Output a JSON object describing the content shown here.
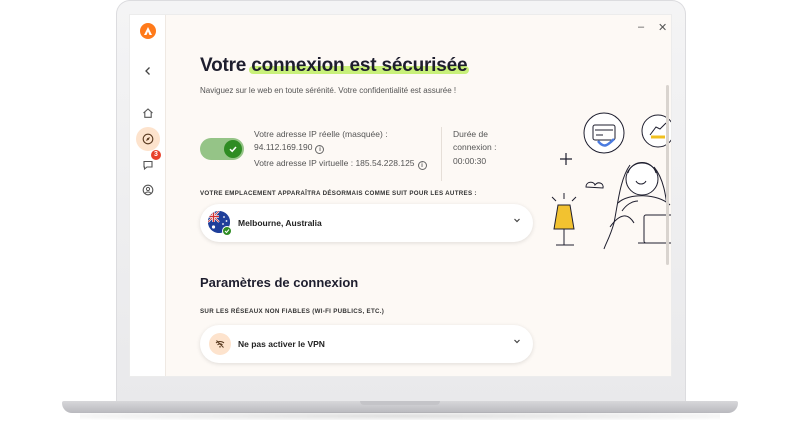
{
  "window": {
    "minimize": "–",
    "close": "✕"
  },
  "rail": {
    "badge_count": "3",
    "items": [
      {
        "name": "home",
        "icon": "home-icon"
      },
      {
        "name": "privacy",
        "icon": "compass-icon",
        "active": true
      },
      {
        "name": "messages",
        "icon": "chat-icon"
      },
      {
        "name": "account",
        "icon": "user-icon"
      }
    ]
  },
  "header": {
    "title_prefix": "Votre ",
    "title_highlight": "connexion est sécurisée",
    "subtitle": "Naviguez sur le web en toute sérénité. Votre confidentialité est assurée !"
  },
  "connection": {
    "toggle_on": true,
    "real_ip_label": "Votre adresse IP réelle (masquée) :",
    "real_ip_value": "94.112.169.190",
    "virtual_ip_label": "Votre adresse IP virtuelle :",
    "virtual_ip_value": "185.54.228.125",
    "duration_label_1": "Durée de",
    "duration_label_2": "connexion :",
    "duration_value": "00:00:30"
  },
  "location": {
    "caption": "VOTRE EMPLACEMENT APPARAÎTRA DÉSORMAIS COMME SUIT POUR LES AUTRES :",
    "value": "Melbourne, Australia"
  },
  "settings": {
    "title": "Paramètres de connexion",
    "caption": "SUR LES RÉSEAUX NON FIABLES (WI-FI PUBLICS, ETC.)",
    "value": "Ne pas activer le VPN"
  },
  "colors": {
    "accent": "#ff7a1a",
    "highlight": "#c8f07a",
    "toggle_on": "#2f8c23"
  }
}
